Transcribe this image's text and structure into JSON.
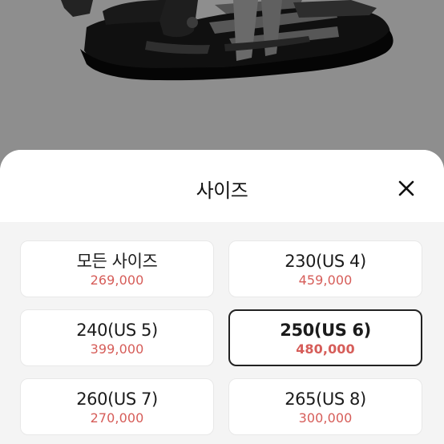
{
  "sheet": {
    "title": "사이즈",
    "close_icon": "close-icon"
  },
  "size_options": [
    {
      "label": "모든 사이즈",
      "price": "269,000",
      "selected": false
    },
    {
      "label": "230(US 4)",
      "price": "459,000",
      "selected": false
    },
    {
      "label": "240(US 5)",
      "price": "399,000",
      "selected": false
    },
    {
      "label": "250(US 6)",
      "price": "480,000",
      "selected": true
    },
    {
      "label": "260(US 7)",
      "price": "270,000",
      "selected": false
    },
    {
      "label": "265(US 8)",
      "price": "300,000",
      "selected": false
    }
  ],
  "colors": {
    "price": "#d65d59",
    "selected_border": "#222222",
    "backdrop": "#8e8e8e"
  }
}
